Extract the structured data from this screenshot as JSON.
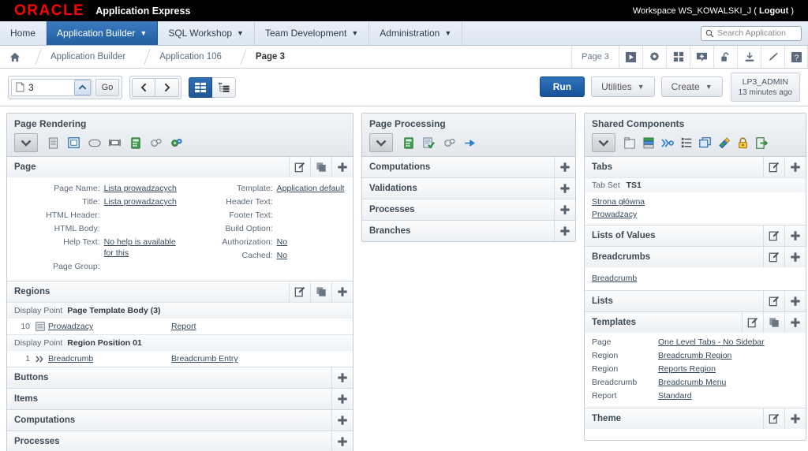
{
  "topbar": {
    "logo": "ORACLE",
    "product": "Application Express",
    "workspace": "Workspace WS_KOWALSKI_J",
    "paren_open": "(",
    "logout": "Logout",
    "paren_close": ")"
  },
  "nav": {
    "items": [
      {
        "label": "Home",
        "caret": false,
        "active": false
      },
      {
        "label": "Application Builder",
        "caret": true,
        "active": true
      },
      {
        "label": "SQL Workshop",
        "caret": true,
        "active": false
      },
      {
        "label": "Team Development",
        "caret": true,
        "active": false
      },
      {
        "label": "Administration",
        "caret": true,
        "active": false
      }
    ],
    "search_placeholder": "Search Application"
  },
  "breadcrumb": {
    "home_icon": "home-icon",
    "items": [
      "Application Builder",
      "Application 106",
      "Page 3"
    ],
    "page_label": "Page 3",
    "icons": [
      "run-page-icon",
      "page-settings-icon",
      "grid-icon",
      "comment-add-icon",
      "lock-open-icon",
      "export-icon",
      "edit-pencil-icon",
      "help-icon"
    ]
  },
  "toolbar": {
    "page_number": "3",
    "page_icon": "page-icon",
    "spinner_icon": "chevron-up-icon",
    "go_label": "Go",
    "prev_icon": "chevron-left-icon",
    "next_icon": "chevron-right-icon",
    "view_grid_icon": "grid-view-icon",
    "view_tree_icon": "tree-view-icon",
    "run_label": "Run",
    "utilities_label": "Utilities",
    "create_label": "Create",
    "user_name": "LP3_ADMIN",
    "user_time": "13 minutes ago"
  },
  "page_rendering": {
    "title": "Page Rendering",
    "icons": [
      "chevron-down-icon",
      "page-icon",
      "region-icon",
      "button-icon",
      "item-icon",
      "computation-icon",
      "process-icon",
      "dynamic-action-icon"
    ],
    "page_section": {
      "title": "Page",
      "actions": [
        "edit-icon",
        "copy-icon",
        "add-icon"
      ],
      "left": [
        {
          "label": "Page Name:",
          "value": "Lista prowadzacych",
          "link": true
        },
        {
          "label": "Title:",
          "value": "Lista prowadzacych",
          "link": true
        },
        {
          "label": "HTML Header:",
          "value": "",
          "link": false
        },
        {
          "label": "HTML Body:",
          "value": "",
          "link": false
        },
        {
          "label": "Help Text:",
          "value": "No help is available for this",
          "link": true
        },
        {
          "label": "Page Group:",
          "value": "",
          "link": false
        }
      ],
      "right": [
        {
          "label": "Template:",
          "value": "Application default",
          "link": true
        },
        {
          "label": "Header Text:",
          "value": "",
          "link": false
        },
        {
          "label": "Footer Text:",
          "value": "",
          "link": false
        },
        {
          "label": "Build Option:",
          "value": "",
          "link": false
        },
        {
          "label": "Authorization:",
          "value": "No",
          "link": true
        },
        {
          "label": "Cached:",
          "value": "No",
          "link": true
        }
      ]
    },
    "regions_section": {
      "title": "Regions",
      "actions": [
        "edit-icon",
        "copy-icon",
        "add-icon"
      ],
      "groups": [
        {
          "display_point_label": "Display Point",
          "display_point_value": "Page Template Body (3)",
          "rows": [
            {
              "seq": "10",
              "icon": "report-region-icon",
              "name": "Prowadzacy",
              "type": "Report"
            }
          ]
        },
        {
          "display_point_label": "Display Point",
          "display_point_value": "Region Position 01",
          "rows": [
            {
              "seq": "1",
              "icon": "breadcrumb-region-icon",
              "name": "Breadcrumb",
              "type": "Breadcrumb Entry"
            }
          ]
        }
      ]
    },
    "simple_sections": [
      {
        "title": "Buttons",
        "action": "add-icon"
      },
      {
        "title": "Items",
        "action": "add-icon"
      },
      {
        "title": "Computations",
        "action": "add-icon"
      },
      {
        "title": "Processes",
        "action": "add-icon"
      }
    ]
  },
  "page_processing": {
    "title": "Page Processing",
    "icons": [
      "chevron-down-icon",
      "computation-icon",
      "validation-icon",
      "process-icon",
      "branch-icon"
    ],
    "sections": [
      {
        "title": "Computations",
        "action": "add-icon"
      },
      {
        "title": "Validations",
        "action": "add-icon"
      },
      {
        "title": "Processes",
        "action": "add-icon"
      },
      {
        "title": "Branches",
        "action": "add-icon"
      }
    ]
  },
  "shared_components": {
    "title": "Shared Components",
    "icons": [
      "chevron-down-icon",
      "tabs-icon",
      "lov-icon",
      "breadcrumb-icon",
      "lists-icon",
      "templates-icon",
      "theme-icon",
      "security-lock-icon",
      "navigation-icon"
    ],
    "tabs": {
      "title": "Tabs",
      "actions": [
        "edit-icon",
        "add-icon"
      ],
      "tabset_label": "Tab Set",
      "tabset_value": "TS1",
      "links": [
        "Strona główna",
        "Prowadzacy"
      ]
    },
    "lov": {
      "title": "Lists of Values",
      "actions": [
        "edit-icon",
        "add-icon"
      ]
    },
    "breadcrumbs": {
      "title": "Breadcrumbs",
      "actions": [
        "edit-icon",
        "add-icon"
      ],
      "links": [
        "Breadcrumb"
      ]
    },
    "lists": {
      "title": "Lists",
      "actions": [
        "edit-icon",
        "add-icon"
      ]
    },
    "templates": {
      "title": "Templates",
      "actions": [
        "edit-icon",
        "copy-icon",
        "add-icon"
      ],
      "rows": [
        {
          "kind": "Page",
          "name": "One Level Tabs - No Sidebar"
        },
        {
          "kind": "Region",
          "name": "Breadcrumb Region"
        },
        {
          "kind": "Region",
          "name": "Reports Region"
        },
        {
          "kind": "Breadcrumb",
          "name": "Breadcrumb Menu"
        },
        {
          "kind": "Report",
          "name": "Standard"
        }
      ]
    },
    "theme": {
      "title": "Theme",
      "actions": [
        "edit-icon",
        "add-icon"
      ]
    }
  },
  "colors": {
    "brand_red": "#ff0000",
    "nav_active": "#2a6cb0",
    "run_button": "#1f5795",
    "topbar_bg": "#000000",
    "panel_border": "#c4ccd6"
  }
}
